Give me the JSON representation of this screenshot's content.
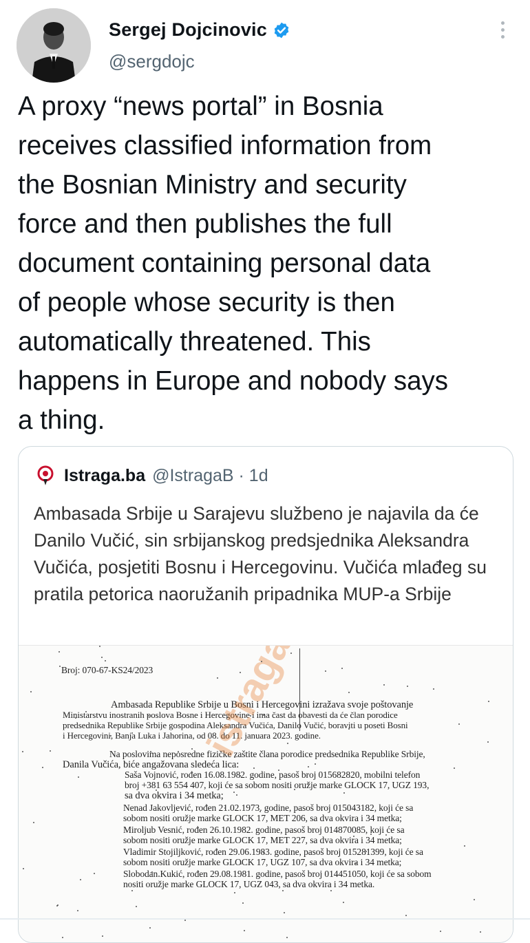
{
  "tweet": {
    "display_name": "Sergej Dojcinovic",
    "handle": "@sergdojc",
    "text": "A proxy “news portal” in Bosnia\nreceives classified information from\nthe Bosnian Ministry and security\nforce and then publishes the full\ndocument containing personal data\nof people whose security is then\nautomatically threatened. This\nhappens in Europe and nobody says\na thing.",
    "verified_color": "#1d9bf0",
    "more_icon": "vertical-ellipsis-icon"
  },
  "quote": {
    "display_name": "Istraga.ba",
    "handle": "@IstragaB · 1d",
    "text": "Ambasada Srbije u Sarajevu službeno je najavila da će Danilo Vučić, sin srbijanskog predsjednika Aleksandra Vučića, posjetiti Bosnu i Hercegovinu. Vučića mlađeg su pratila petorica naoružanih pripadnika MUP-a Srbije",
    "logo_icon": "istraga-logo-icon",
    "logo_color": "#c8102e"
  },
  "document": {
    "ref": "Broj: 070-67-KS24/2023",
    "watermark": "istraga.ba",
    "lines": [
      "Ambasada Republike Srbije u Bosni i Hercegovini izražava svoje poštovanje",
      "Ministarstvu inostranih poslova Bosne i Hercegovine i ima čast da obavesti da će član porodice",
      "predsednika Republike Srbije gospodina Aleksandra Vučića, Danilo Vučić, boraviti u poseti Bosni",
      "i Hercegovini, Banja Luka i Jahorina, od 08. do 11. januara 2023. godine.",
      "Na poslovima neposredne fizičke zaštite člana porodice predsednika Republike Srbije,",
      "Danila Vučića, biće angažovana sledeća lica:",
      "Saša Vojnović, rođen 16.08.1982. godine, pasoš broj 015682820, mobilni telefon",
      "broj +381 63 554 407, koji će sa sobom nositi oružje marke GLOCK 17, UGZ 193,",
      "sa dva okvira i 34 metka;",
      "Nenad Jakovljević, rođen 21.02.1973. godine, pasoš broj 015043182, koji će sa",
      "sobom nositi oružje marke GLOCK 17, MET 206, sa dva okvira i 34 metka;",
      "Miroljub Vesnić, rođen 26.10.1982. godine, pasoš broj 014870085, koji će sa",
      "sobom nositi oružje marke GLOCK 17, MET 227, sa dva okvira i 34 metka;",
      "Vladimir Stojiljković, rođen 29.06.1983. godine, pasoš broj 015281399, koji će sa",
      "sobom nositi oružje marke GLOCK 17, UGZ 107, sa dva okvira i 34 metka;",
      "Slobodan Kukić, rođen 29.08.1981. godine, pasoš broj 014451050, koji će sa sobom",
      "nositi oružje marke GLOCK 17, UGZ 043, sa dva okvira i 34 metka."
    ]
  }
}
